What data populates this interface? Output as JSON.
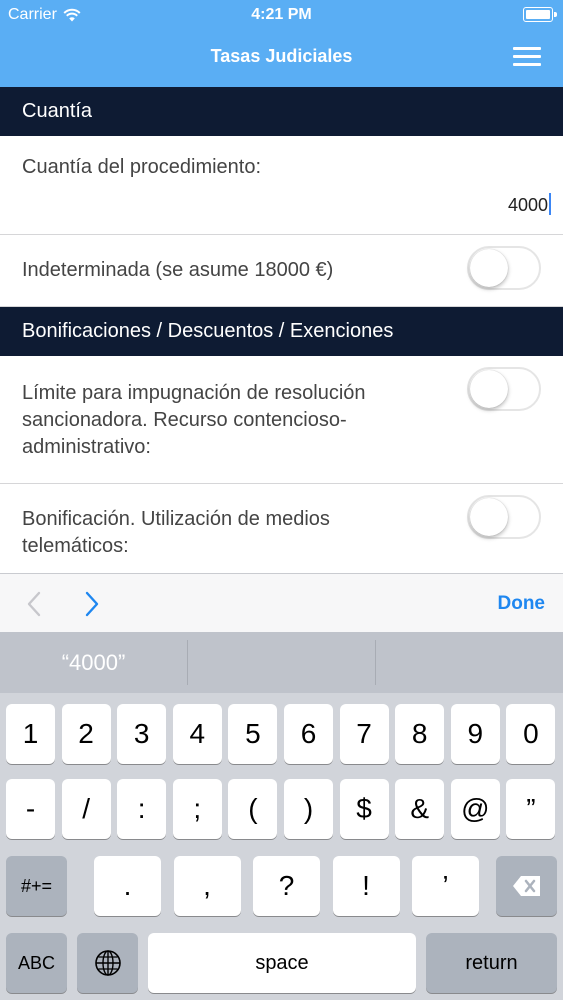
{
  "status_bar": {
    "carrier": "Carrier",
    "time": "4:21 PM"
  },
  "nav": {
    "title": "Tasas Judiciales",
    "menu_icon": "hamburger-menu-icon"
  },
  "sections": {
    "amount": "Cuantía",
    "discounts": "Bonificaciones / Descuentos / Exenciones"
  },
  "cells": {
    "procedure_amount_label": "Cuantía del procedimiento:",
    "procedure_amount_value": "4000",
    "indeterminate_label": "Indeterminada (se asume 18000 €)",
    "challenge_limit_label": "Límite para impugnación de resolución sancionadora. Recurso contencioso-administrativo:",
    "telematic_label": "Bonificación. Utilización de medios telemáticos:"
  },
  "toggles": {
    "indeterminate": false,
    "challenge_limit": false,
    "telematic": false
  },
  "accessory": {
    "done_label": "Done",
    "prev_icon": "chevron-left-icon",
    "next_icon": "chevron-right-icon"
  },
  "predictive": {
    "suggestion": "“4000”"
  },
  "keyboard": {
    "row1": [
      "1",
      "2",
      "3",
      "4",
      "5",
      "6",
      "7",
      "8",
      "9",
      "0"
    ],
    "row2": [
      "-",
      "/",
      ":",
      ";",
      "(",
      ")",
      "$",
      "&",
      "@",
      "”"
    ],
    "row3": [
      ".",
      ",",
      "?",
      "!",
      "’"
    ],
    "symbols_key": "#+=",
    "abc_key": "ABC",
    "space_key": "space",
    "return_key": "return"
  }
}
